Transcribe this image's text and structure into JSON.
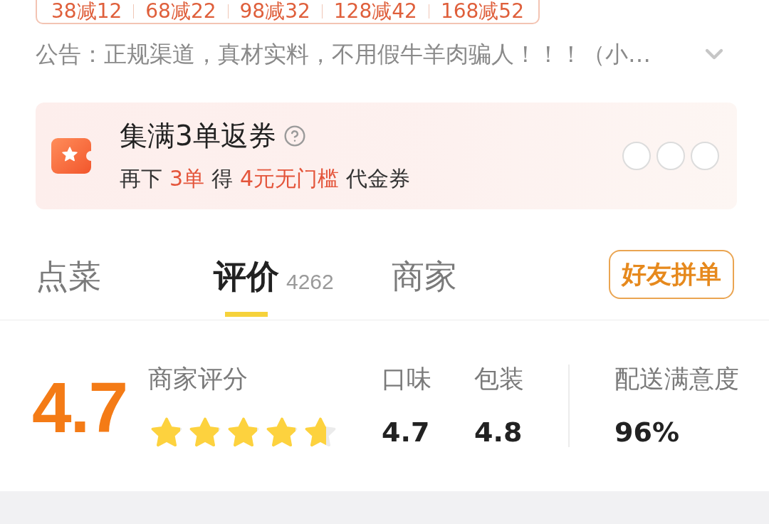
{
  "promo_tags": [
    "38减12",
    "68减22",
    "98减32",
    "128减42",
    "168减52"
  ],
  "notice": {
    "text": "公告：正规渠道，真材实料，不用假牛羊肉骗人！！！（小…",
    "expanded": false
  },
  "coupon": {
    "title": "集满3单返券",
    "segments": [
      {
        "text": "再下",
        "highlight": false
      },
      {
        "text": "3单",
        "highlight": true
      },
      {
        "text": "得",
        "highlight": false
      },
      {
        "text": "4元无门槛",
        "highlight": true
      },
      {
        "text": "代金券",
        "highlight": false
      }
    ],
    "slots": [
      {
        "done": false
      },
      {
        "done": false
      },
      {
        "done": false
      }
    ]
  },
  "tabs": [
    {
      "label": "点菜",
      "selected": false
    },
    {
      "label": "评价",
      "count": "4262",
      "selected": true
    },
    {
      "label": "商家",
      "selected": false
    }
  ],
  "group_order_button": "好友拼单",
  "rating": {
    "score": "4.7",
    "label": "商家评分",
    "stars": 4.7
  },
  "dish_scores": [
    {
      "label": "口味",
      "value": "4.7"
    },
    {
      "label": "包装",
      "value": "4.8"
    }
  ],
  "delivery_score": {
    "label": "配送满意度",
    "value": "96%"
  }
}
